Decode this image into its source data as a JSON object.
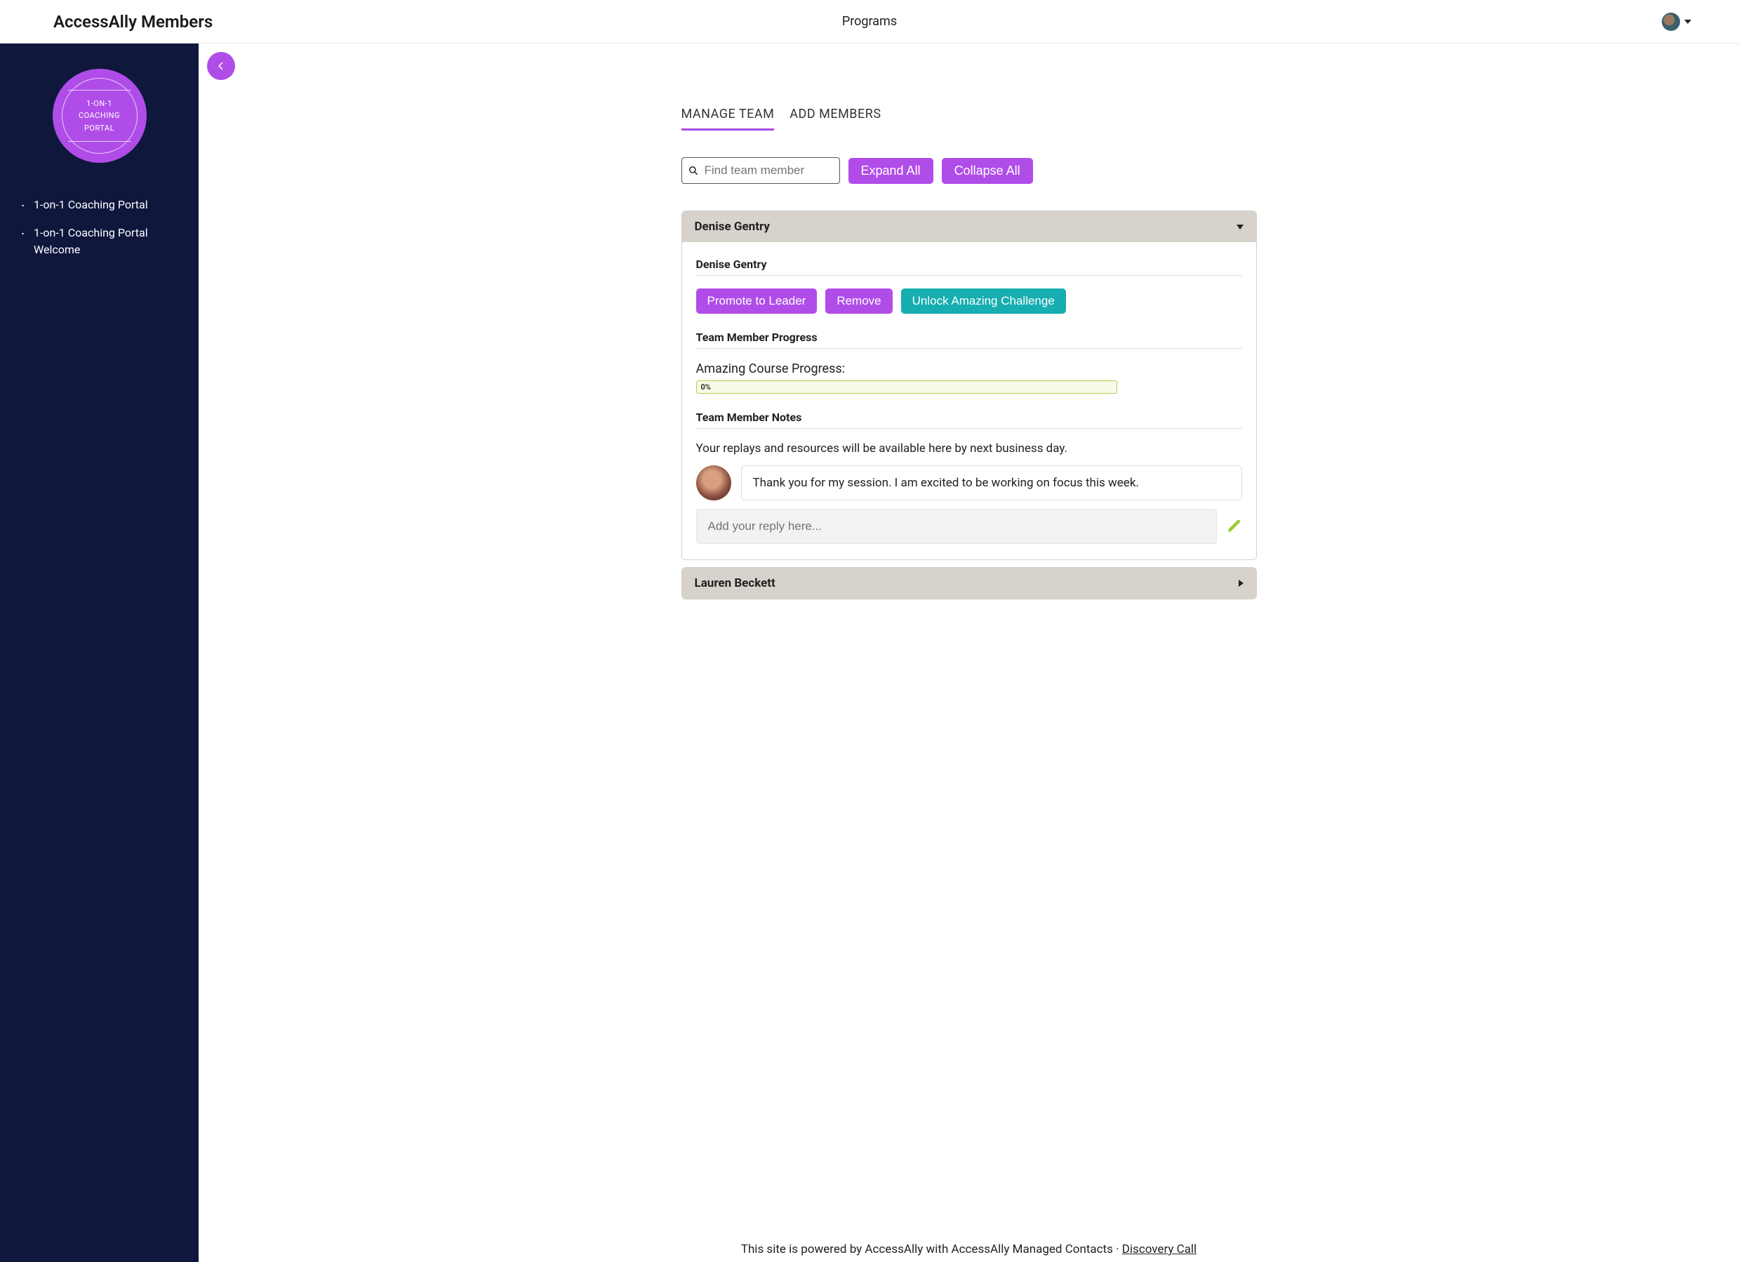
{
  "colors": {
    "accent_purple": "#b04de8",
    "accent_teal": "#16aeb0",
    "sidebar_bg": "#0f173d"
  },
  "topbar": {
    "title": "AccessAlly Members",
    "center_link": "Programs"
  },
  "sidebar": {
    "badge_text": "1-ON-1\nCOACHING\nPORTAL",
    "items": [
      {
        "label": "1-on-1 Coaching Portal"
      },
      {
        "label": "1-on-1 Coaching Portal Welcome"
      }
    ]
  },
  "tabs": [
    {
      "label": "MANAGE TEAM",
      "active": true
    },
    {
      "label": "ADD MEMBERS",
      "active": false
    }
  ],
  "search": {
    "placeholder": "Find team member"
  },
  "buttons": {
    "expand_all": "Expand All",
    "collapse_all": "Collapse All"
  },
  "team": [
    {
      "name": "Denise Gentry",
      "expanded": true,
      "member_name": "Denise Gentry",
      "actions": {
        "promote": "Promote to Leader",
        "remove": "Remove",
        "unlock": "Unlock Amazing Challenge"
      },
      "headings": {
        "progress": "Team Member Progress",
        "notes": "Team Member Notes"
      },
      "progress": {
        "label": "Amazing Course Progress:",
        "value_text": "0%"
      },
      "notes_intro": "Your replays and resources will be available here by next business day.",
      "note_message": "Thank you for my session. I am excited to be working on focus this week.",
      "reply_placeholder": "Add your reply here..."
    },
    {
      "name": "Lauren Beckett",
      "expanded": false
    }
  ],
  "footer": {
    "text_prefix": "This site is powered by AccessAlly with AccessAlly Managed Contacts · ",
    "link_text": "Discovery Call"
  }
}
